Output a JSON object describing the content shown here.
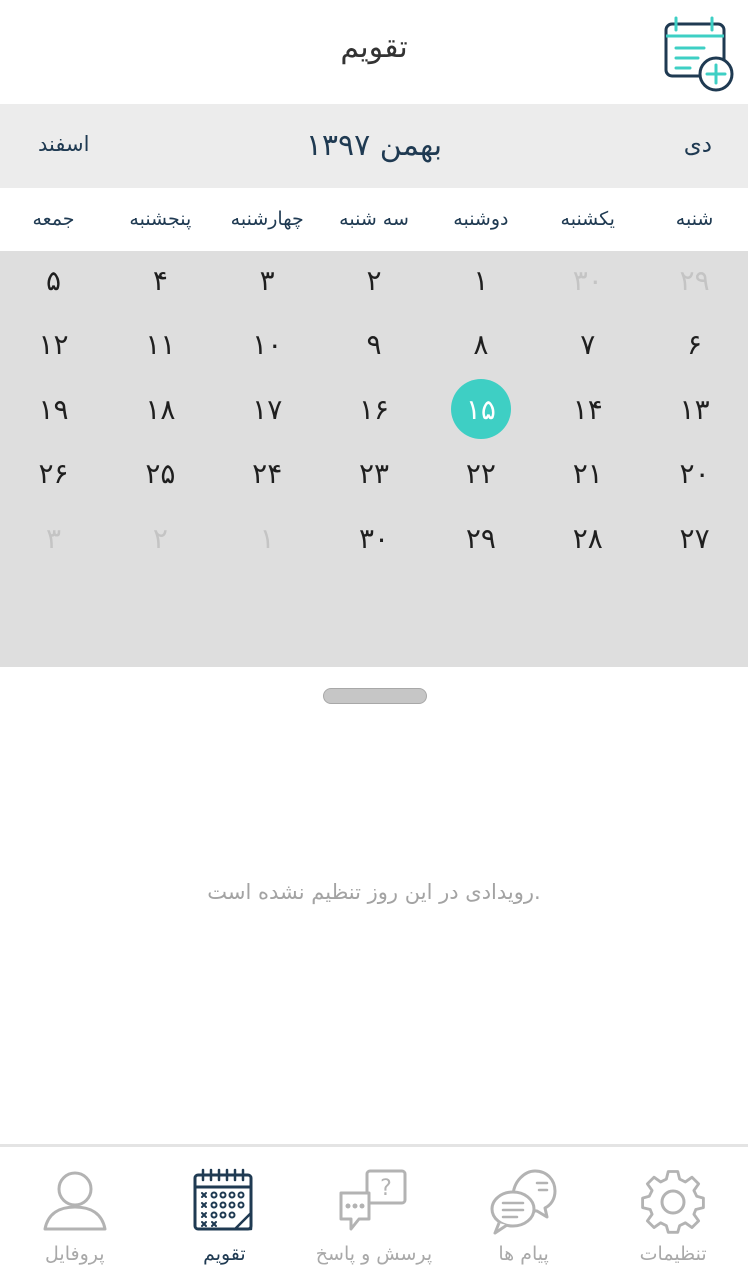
{
  "header": {
    "title": "تقویم",
    "add_event_icon": "calendar-add-icon",
    "accent_color": "#3ecfc4",
    "primary_color": "#1f3a52"
  },
  "month_nav": {
    "next_label": "اسفند",
    "current_label": "بهمن ۱۳۹۷",
    "prev_label": "دی"
  },
  "weekdays": [
    "شنبه",
    "یکشنبه",
    "دوشنبه",
    "سه شنبه",
    "چهارشنبه",
    "پنجشنبه",
    "جمعه"
  ],
  "weeks": [
    [
      {
        "label": "۲۹",
        "muted": true
      },
      {
        "label": "۳۰",
        "muted": true
      },
      {
        "label": "۱"
      },
      {
        "label": "۲"
      },
      {
        "label": "۳"
      },
      {
        "label": "۴"
      },
      {
        "label": "۵"
      }
    ],
    [
      {
        "label": "۶"
      },
      {
        "label": "۷"
      },
      {
        "label": "۸"
      },
      {
        "label": "۹"
      },
      {
        "label": "۱۰"
      },
      {
        "label": "۱۱"
      },
      {
        "label": "۱۲"
      }
    ],
    [
      {
        "label": "۱۳"
      },
      {
        "label": "۱۴"
      },
      {
        "label": "۱۵",
        "selected": true
      },
      {
        "label": "۱۶"
      },
      {
        "label": "۱۷"
      },
      {
        "label": "۱۸"
      },
      {
        "label": "۱۹"
      }
    ],
    [
      {
        "label": "۲۰"
      },
      {
        "label": "۲۱"
      },
      {
        "label": "۲۲"
      },
      {
        "label": "۲۳"
      },
      {
        "label": "۲۴"
      },
      {
        "label": "۲۵"
      },
      {
        "label": "۲۶"
      }
    ],
    [
      {
        "label": "۲۷"
      },
      {
        "label": "۲۸"
      },
      {
        "label": "۲۹"
      },
      {
        "label": "۳۰"
      },
      {
        "label": "۱",
        "muted": true
      },
      {
        "label": "۲",
        "muted": true
      },
      {
        "label": "۳",
        "muted": true
      }
    ]
  ],
  "empty_state": "رویدادی در این روز تنظیم نشده است.",
  "bottom_nav": {
    "items": [
      {
        "label": "پروفایل",
        "icon": "profile-icon"
      },
      {
        "label": "تقویم",
        "icon": "calendar-icon",
        "active": true
      },
      {
        "label": "پرسش و پاسخ",
        "icon": "qa-icon"
      },
      {
        "label": "پیام ها",
        "icon": "messages-icon"
      },
      {
        "label": "تنظیمات",
        "icon": "settings-icon"
      }
    ]
  }
}
